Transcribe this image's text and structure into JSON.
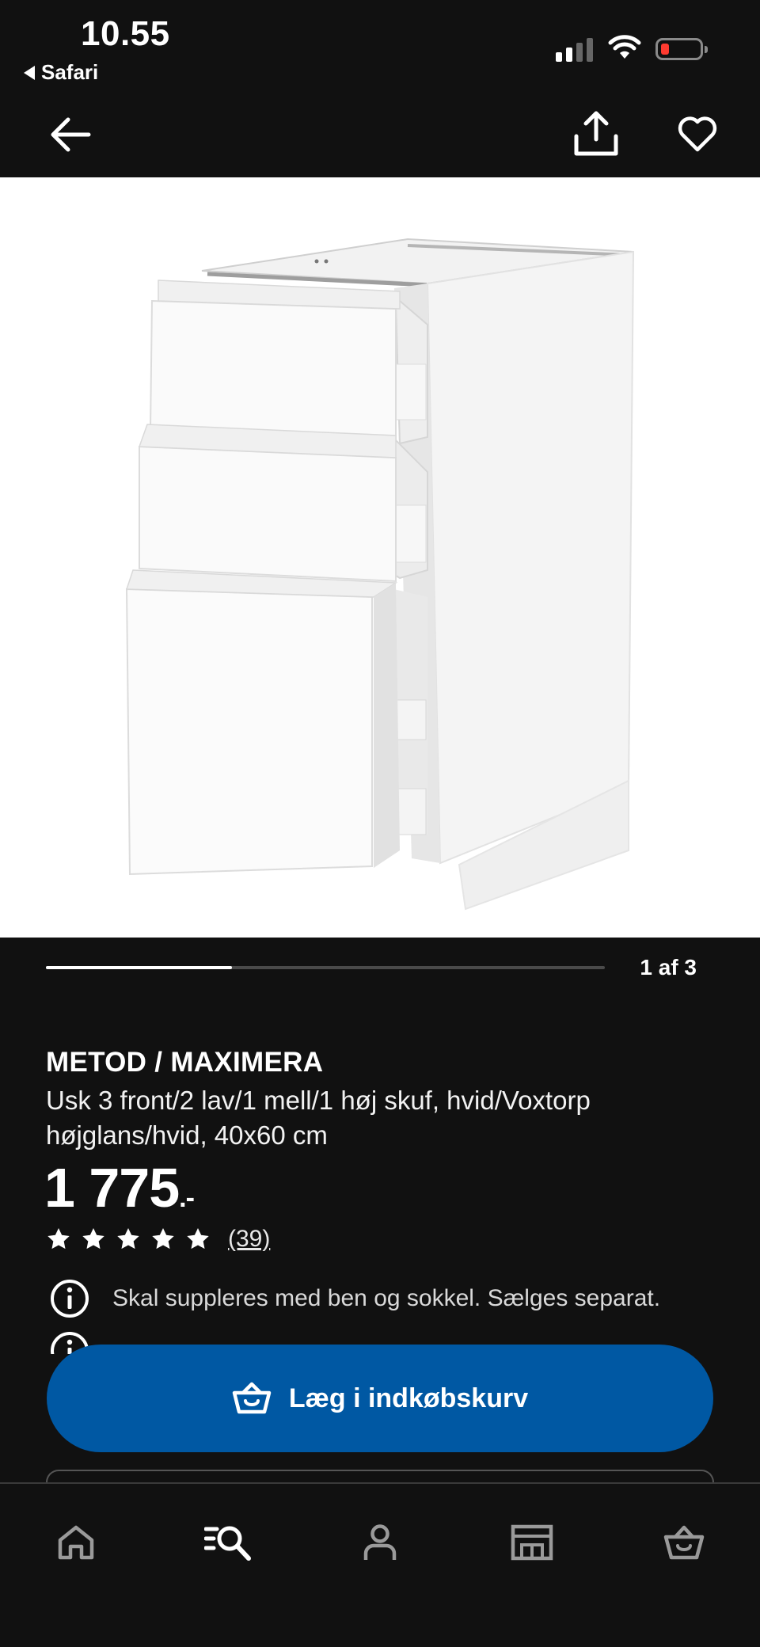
{
  "status_bar": {
    "time": "10.55",
    "back_app": "Safari"
  },
  "gallery": {
    "counter": "1 af 3",
    "current": 1,
    "total": 3,
    "progress": 0.333
  },
  "product": {
    "name": "METOD / MAXIMERA",
    "description": "Usk 3 front/2 lav/1 mell/1 høj skuf, hvid/Voxtorp højglans/hvid, 40x60 cm",
    "price_integer": "1 775",
    "price_suffix": ".-",
    "rating_stars": 5,
    "review_count": "(39)",
    "notice": "Skal suppleres med ben og sokkel. Sælges separat."
  },
  "cart_button": {
    "label": "Læg i indkøbskurv"
  },
  "icons": {
    "nav_back": "arrow-left-icon",
    "nav_share": "share-icon",
    "nav_favorite": "heart-icon",
    "info": "info-icon",
    "cart": "basket-icon",
    "tab_home": "home-icon",
    "tab_search": "search-list-icon",
    "tab_profile": "user-icon",
    "tab_store": "store-icon",
    "tab_cart": "basket-icon"
  },
  "colors": {
    "background": "#111111",
    "accent_blue": "#0058a3",
    "battery_low": "#ff3b30"
  }
}
